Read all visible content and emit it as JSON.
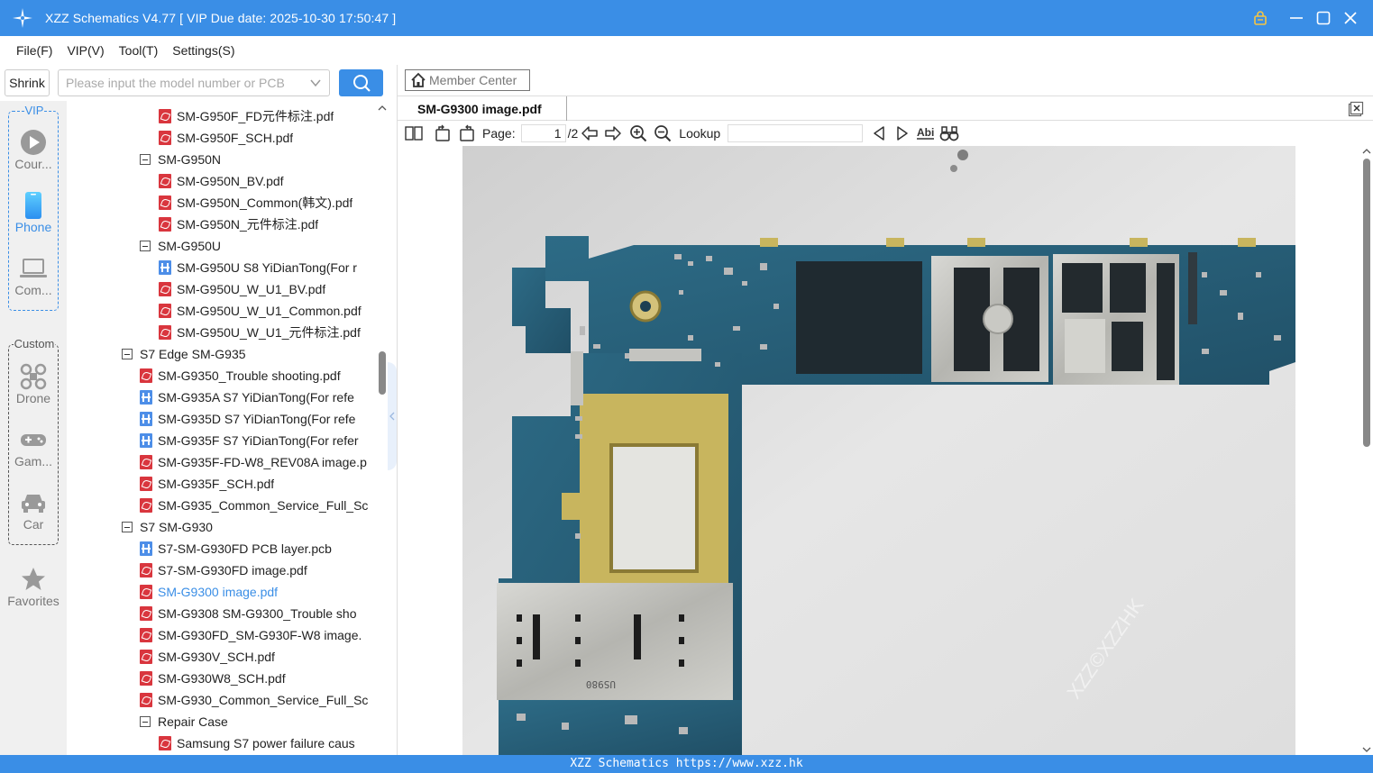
{
  "window": {
    "title": "XZZ Schematics V4.77 [ VIP Due date: 2025-10-30 17:50:47 ]"
  },
  "menu": {
    "items": [
      "File(F)",
      "VIP(V)",
      "Tool(T)",
      "Settings(S)"
    ]
  },
  "search": {
    "shrink_label": "Shrink",
    "placeholder": "Please input the model number or PCB"
  },
  "rail": {
    "vip_label": "VIP",
    "custom_label": "Custom",
    "items": [
      {
        "label": "Cour...",
        "icon": "play-circle-icon"
      },
      {
        "label": "Phone",
        "icon": "phone-icon"
      },
      {
        "label": "Com...",
        "icon": "laptop-icon"
      },
      {
        "label": "Drone",
        "icon": "drone-icon"
      },
      {
        "label": "Gam...",
        "icon": "gamepad-icon"
      },
      {
        "label": "Car",
        "icon": "car-icon"
      },
      {
        "label": "Favorites",
        "icon": "star-icon"
      }
    ]
  },
  "tree": {
    "rows": [
      {
        "type": "pdf",
        "level": 2,
        "label": "SM-G950F_FD元件标注.pdf"
      },
      {
        "type": "pdf",
        "level": 2,
        "label": "SM-G950F_SCH.pdf"
      },
      {
        "type": "folder",
        "level": 1,
        "label": "SM-G950N"
      },
      {
        "type": "pdf",
        "level": 2,
        "label": "SM-G950N_BV.pdf"
      },
      {
        "type": "pdf",
        "level": 2,
        "label": "SM-G950N_Common(韩文).pdf"
      },
      {
        "type": "pdf",
        "level": 2,
        "label": "SM-G950N_元件标注.pdf"
      },
      {
        "type": "folder",
        "level": 1,
        "label": "SM-G950U"
      },
      {
        "type": "pcb",
        "level": 2,
        "label": "SM-G950U S8 YiDianTong(For r"
      },
      {
        "type": "pdf",
        "level": 2,
        "label": "SM-G950U_W_U1_BV.pdf"
      },
      {
        "type": "pdf",
        "level": 2,
        "label": "SM-G950U_W_U1_Common.pdf"
      },
      {
        "type": "pdf",
        "level": 2,
        "label": "SM-G950U_W_U1_元件标注.pdf"
      },
      {
        "type": "folder",
        "level": 0,
        "label": "S7 Edge SM-G935"
      },
      {
        "type": "pdf",
        "level": 1,
        "label": "SM-G9350_Trouble shooting.pdf"
      },
      {
        "type": "pcb",
        "level": 1,
        "label": "SM-G935A S7 YiDianTong(For refe"
      },
      {
        "type": "pcb",
        "level": 1,
        "label": "SM-G935D S7 YiDianTong(For refe"
      },
      {
        "type": "pcb",
        "level": 1,
        "label": "SM-G935F S7 YiDianTong(For refer"
      },
      {
        "type": "pdf",
        "level": 1,
        "label": "SM-G935F-FD-W8_REV08A image.p"
      },
      {
        "type": "pdf",
        "level": 1,
        "label": "SM-G935F_SCH.pdf"
      },
      {
        "type": "pdf",
        "level": 1,
        "label": "SM-G935_Common_Service_Full_Sc"
      },
      {
        "type": "folder",
        "level": 0,
        "label": "S7 SM-G930"
      },
      {
        "type": "pcb",
        "level": 1,
        "label": "S7-SM-G930FD PCB layer.pcb"
      },
      {
        "type": "pdf",
        "level": 1,
        "label": "S7-SM-G930FD image.pdf"
      },
      {
        "type": "pdf",
        "level": 1,
        "label": "SM-G9300 image.pdf",
        "selected": true
      },
      {
        "type": "pdf",
        "level": 1,
        "label": "SM-G9308 SM-G9300_Trouble sho"
      },
      {
        "type": "pdf",
        "level": 1,
        "label": "SM-G930FD_SM-G930F-W8 image."
      },
      {
        "type": "pdf",
        "level": 1,
        "label": "SM-G930V_SCH.pdf"
      },
      {
        "type": "pdf",
        "level": 1,
        "label": "SM-G930W8_SCH.pdf"
      },
      {
        "type": "pdf",
        "level": 1,
        "label": "SM-G930_Common_Service_Full_Sc"
      },
      {
        "type": "folder",
        "level": 1,
        "label": "Repair Case"
      },
      {
        "type": "pdf",
        "level": 2,
        "label": "Samsung S7 power failure caus"
      }
    ]
  },
  "right": {
    "member_center": "Member Center",
    "tab_title": "SM-G9300 image.pdf",
    "page_label": "Page:",
    "page_current": "1",
    "page_total": "/2",
    "lookup_label": "Lookup",
    "image_watermark": "XZZ©XZZHK"
  },
  "status": {
    "text": "XZZ Schematics https://www.xzz.hk"
  },
  "colors": {
    "accent": "#3a8ee6",
    "pdf_icon": "#d9363e",
    "pcb_icon": "#4d8ee8"
  }
}
